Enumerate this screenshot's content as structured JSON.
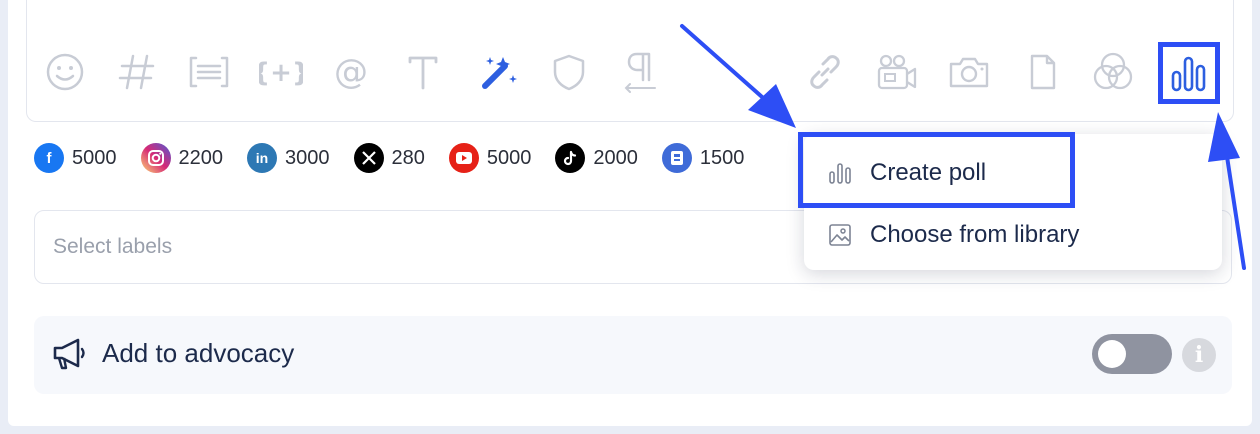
{
  "toolbar": {
    "icons": [
      "emoji-icon",
      "hashtag-icon",
      "text-block-icon",
      "variable-icon",
      "mention-icon",
      "font-icon",
      "magic-wand-icon",
      "shield-icon",
      "paragraph-icon",
      "link-icon",
      "video-camera-icon",
      "camera-icon",
      "document-icon",
      "color-circles-icon",
      "poll-chart-icon"
    ],
    "accent_color": "#2d4ef5"
  },
  "char_counts": [
    {
      "network": "facebook",
      "icon": "facebook-icon",
      "value": "5000",
      "color": "#1877f2"
    },
    {
      "network": "instagram",
      "icon": "instagram-icon",
      "value": "2200",
      "color": "#d62976"
    },
    {
      "network": "linkedin",
      "icon": "linkedin-icon",
      "value": "3000",
      "color": "#2d78b4"
    },
    {
      "network": "x",
      "icon": "x-icon",
      "value": "280",
      "color": "#000000"
    },
    {
      "network": "youtube",
      "icon": "youtube-icon",
      "value": "5000",
      "color": "#e62117"
    },
    {
      "network": "tiktok",
      "icon": "tiktok-icon",
      "value": "2000",
      "color": "#000000"
    },
    {
      "network": "google-business",
      "icon": "google-business-icon",
      "value": "1500",
      "color": "#3f6bd8"
    }
  ],
  "labels": {
    "placeholder": "Select labels"
  },
  "advocacy": {
    "label": "Add to advocacy",
    "toggle_on": false
  },
  "dropdown": {
    "items": [
      {
        "label": "Create poll",
        "icon": "poll-icon"
      },
      {
        "label": "Choose from library",
        "icon": "image-icon"
      }
    ]
  }
}
